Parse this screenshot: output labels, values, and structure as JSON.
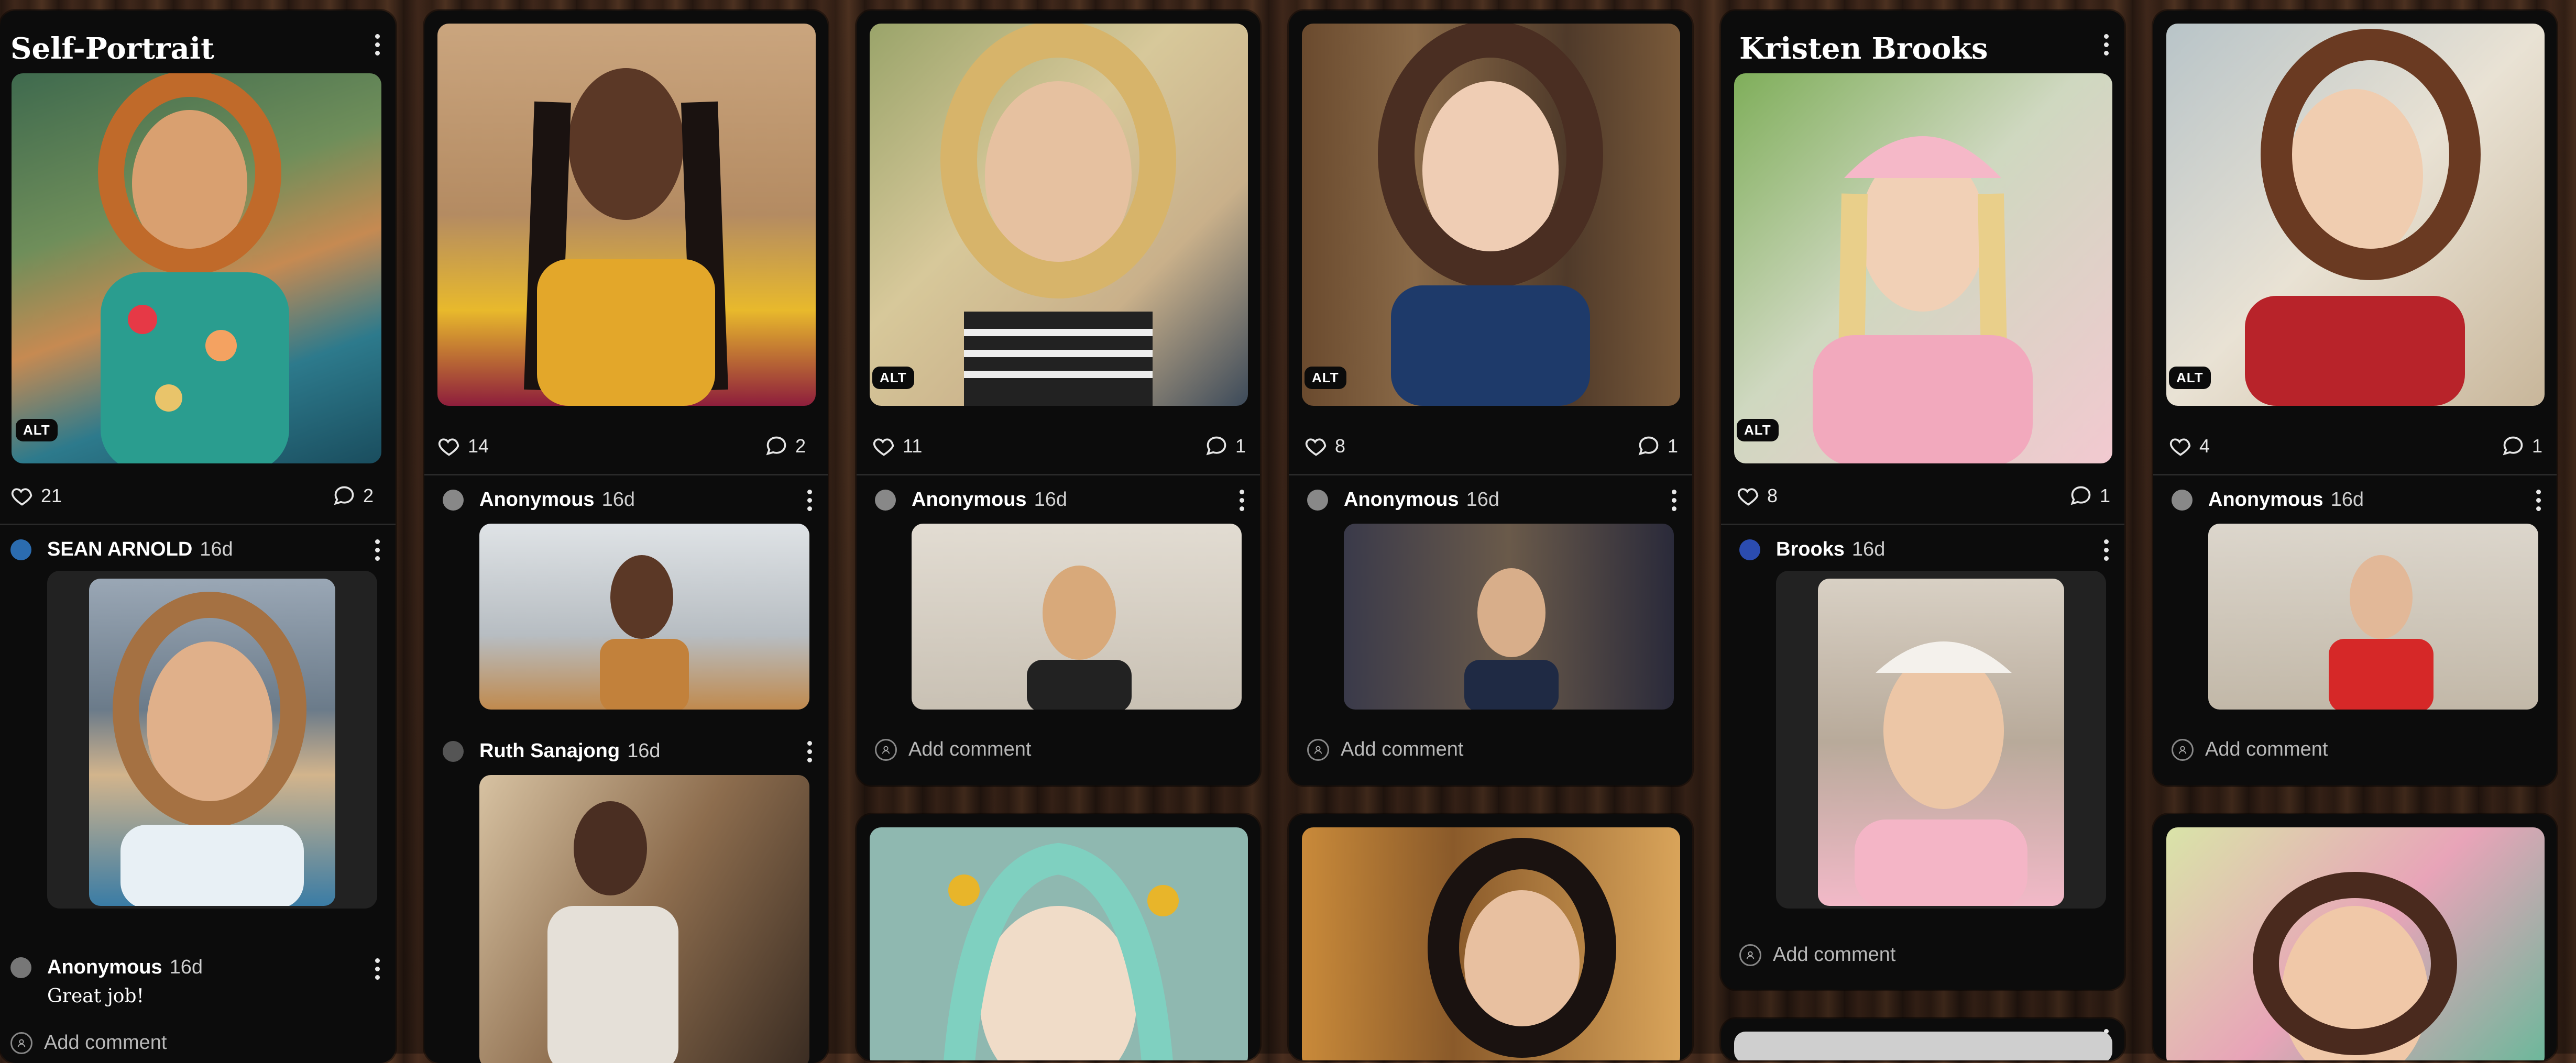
{
  "columns": [
    {
      "title": "Self-Portrait",
      "likes": "21",
      "comments": "2",
      "alt_label": "ALT",
      "feed": [
        {
          "name": "SEAN ARNOLD",
          "time": "16d"
        },
        {
          "name": "Anonymous",
          "time": "16d",
          "text": "Great job!"
        }
      ],
      "add_comment": "Add comment"
    },
    {
      "likes": "14",
      "comments": "2",
      "feed": [
        {
          "name": "Anonymous",
          "time": "16d"
        },
        {
          "name": "Ruth Sanajong",
          "time": "16d"
        }
      ]
    },
    {
      "likes": "11",
      "comments": "1",
      "alt_label": "ALT",
      "feed": [
        {
          "name": "Anonymous",
          "time": "16d"
        }
      ],
      "add_comment": "Add comment"
    },
    {
      "likes": "8",
      "comments": "1",
      "alt_label": "ALT",
      "feed": [
        {
          "name": "Anonymous",
          "time": "16d"
        }
      ],
      "add_comment": "Add comment"
    },
    {
      "title": "Kristen Brooks",
      "likes": "8",
      "comments": "1",
      "alt_label": "ALT",
      "feed": [
        {
          "name": "Brooks",
          "time": "16d"
        }
      ],
      "add_comment": "Add comment"
    },
    {
      "likes": "4",
      "comments": "1",
      "alt_label": "ALT",
      "feed": [
        {
          "name": "Anonymous",
          "time": "16d"
        }
      ],
      "add_comment": "Add comment"
    }
  ],
  "colors": {
    "card_bg": "#0c0c0c",
    "text": "#ffffff",
    "muted": "#b8b8b8"
  },
  "icons": [
    "heart-icon",
    "comment-icon",
    "kebab-menu-icon",
    "add-comment-icon"
  ]
}
